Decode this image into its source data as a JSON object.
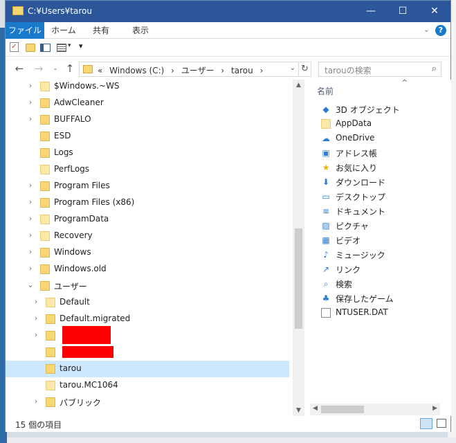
{
  "window": {
    "title": "C:¥Users¥tarou"
  },
  "titlebar": {
    "minimize": "—",
    "maximize": "☐",
    "close": "✕"
  },
  "ribbon": {
    "tabs": [
      "ファイル",
      "ホーム",
      "共有",
      "表示"
    ],
    "collapse_glyph": "⌄",
    "help_glyph": "?"
  },
  "address": {
    "prefix": "«",
    "crumbs": [
      "Windows (C:)",
      "›",
      "ユーザー",
      "›",
      "tarou",
      "›"
    ],
    "dropdown_glyph": "⌄",
    "refresh_glyph": "↻"
  },
  "search": {
    "placeholder": "tarouの検索",
    "icon": "search-icon"
  },
  "nav": {
    "back": "←",
    "forward": "→",
    "history": "⌄",
    "up": "↑"
  },
  "tree": [
    {
      "label": "$Windows.~WS",
      "expandable": true,
      "level": 1
    },
    {
      "label": "AdwCleaner",
      "expandable": true,
      "level": 1
    },
    {
      "label": "BUFFALO",
      "expandable": true,
      "level": 1
    },
    {
      "label": "ESD",
      "expandable": false,
      "level": 1
    },
    {
      "label": "Logs",
      "expandable": false,
      "level": 1
    },
    {
      "label": "PerfLogs",
      "expandable": false,
      "level": 1
    },
    {
      "label": "Program Files",
      "expandable": true,
      "level": 1
    },
    {
      "label": "Program Files (x86)",
      "expandable": true,
      "level": 1
    },
    {
      "label": "ProgramData",
      "expandable": true,
      "level": 1
    },
    {
      "label": "Recovery",
      "expandable": true,
      "level": 1
    },
    {
      "label": "Windows",
      "expandable": true,
      "level": 1
    },
    {
      "label": "Windows.old",
      "expandable": true,
      "level": 1
    },
    {
      "label": "ユーザー",
      "expandable": true,
      "expanded": true,
      "level": 1
    },
    {
      "label": "Default",
      "expandable": true,
      "level": 2
    },
    {
      "label": "Default.migrated",
      "expandable": true,
      "level": 2
    },
    {
      "label": "",
      "expandable": true,
      "level": 2,
      "redacted": true
    },
    {
      "label": "",
      "expandable": false,
      "level": 2,
      "redacted": true
    },
    {
      "label": "tarou",
      "expandable": false,
      "level": 2,
      "selected": true
    },
    {
      "label": "tarou.MC1064",
      "expandable": false,
      "level": 2
    },
    {
      "label": "パブリック",
      "expandable": true,
      "level": 2
    }
  ],
  "content": {
    "column_header": "名前",
    "sort_glyph": "^",
    "items": [
      {
        "label": "3D オブジェクト",
        "icon": "3d-objects-icon",
        "glyph": "◆"
      },
      {
        "label": "AppData",
        "icon": "folder-icon",
        "glyph": ""
      },
      {
        "label": "OneDrive",
        "icon": "onedrive-icon",
        "glyph": "☁"
      },
      {
        "label": "アドレス帳",
        "icon": "contacts-icon",
        "glyph": "▣"
      },
      {
        "label": "お気に入り",
        "icon": "star-icon",
        "glyph": "★"
      },
      {
        "label": "ダウンロード",
        "icon": "download-icon",
        "glyph": "⬇"
      },
      {
        "label": "デスクトップ",
        "icon": "desktop-icon",
        "glyph": "▭"
      },
      {
        "label": "ドキュメント",
        "icon": "document-icon",
        "glyph": "≡"
      },
      {
        "label": "ピクチャ",
        "icon": "pictures-icon",
        "glyph": "▨"
      },
      {
        "label": "ビデオ",
        "icon": "video-icon",
        "glyph": "▦"
      },
      {
        "label": "ミュージック",
        "icon": "music-icon",
        "glyph": "♪"
      },
      {
        "label": "リンク",
        "icon": "link-icon",
        "glyph": "↗"
      },
      {
        "label": "検索",
        "icon": "search-icon",
        "glyph": "⌕"
      },
      {
        "label": "保存したゲーム",
        "icon": "saved-games-icon",
        "glyph": "♣"
      },
      {
        "label": "NTUSER.DAT",
        "icon": "file-icon",
        "glyph": ""
      }
    ]
  },
  "status": {
    "text": "15 個の項目"
  },
  "colors": {
    "titlebar": "#2b579a",
    "file_tab": "#1979ca",
    "selection": "#cce8ff",
    "redaction": "#ff0000",
    "folder": "#f7d774"
  }
}
